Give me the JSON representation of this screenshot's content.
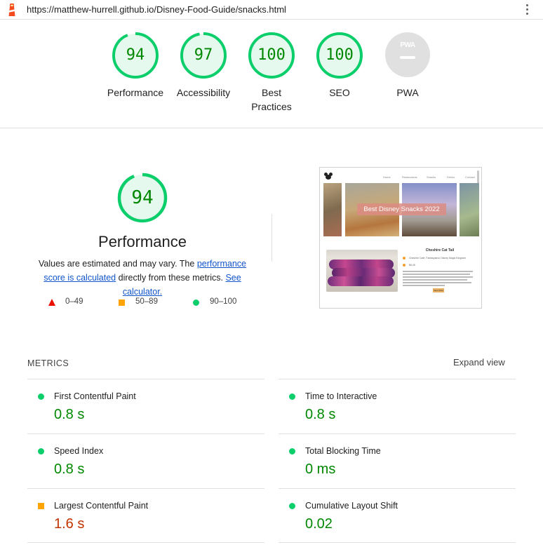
{
  "browser": {
    "url": "https://matthew-hurrell.github.io/Disney-Food-Guide/snacks.html"
  },
  "gauges": [
    {
      "label": "Performance",
      "score": "94",
      "fraction": 0.94,
      "status": "pass"
    },
    {
      "label": "Accessibility",
      "score": "97",
      "fraction": 0.97,
      "status": "pass"
    },
    {
      "label": "Best Practices",
      "score": "100",
      "fraction": 1.0,
      "status": "pass"
    },
    {
      "label": "SEO",
      "score": "100",
      "fraction": 1.0,
      "status": "pass"
    },
    {
      "label": "PWA",
      "score": "",
      "status": "na",
      "badge_text": "PWA"
    }
  ],
  "performance": {
    "score": "94",
    "fraction": 0.94,
    "title": "Performance",
    "desc_prefix": "Values are estimated and may vary. The ",
    "link_score": "performance score is calculated",
    "desc_middle": " directly from these metrics. ",
    "link_calc": "See calculator."
  },
  "legend": [
    {
      "label": "0–49",
      "shape": "triangle",
      "color": "#eb0f00"
    },
    {
      "label": "50–89",
      "shape": "square",
      "color": "#ffa400"
    },
    {
      "label": "90–100",
      "shape": "circle",
      "color": "#0cce6b"
    }
  ],
  "screenshot": {
    "nav": [
      "Home",
      "Restaurants",
      "Snacks",
      "Drinks",
      "Contact"
    ],
    "banner": "Best Disney Snacks 2022",
    "card_title": "Cheshire Cat Tail",
    "info": [
      "Cheshire Café, Fantasyland, Disney Magic Kingdom",
      "$6.49"
    ],
    "more_button": "View More"
  },
  "metrics": {
    "heading": "METRICS",
    "expand_label": "Expand view",
    "items": [
      {
        "name": "First Contentful Paint",
        "value": "0.8 s",
        "status": "pass"
      },
      {
        "name": "Time to Interactive",
        "value": "0.8 s",
        "status": "pass"
      },
      {
        "name": "Speed Index",
        "value": "0.8 s",
        "status": "pass"
      },
      {
        "name": "Total Blocking Time",
        "value": "0 ms",
        "status": "pass"
      },
      {
        "name": "Largest Contentful Paint",
        "value": "1.6 s",
        "status": "average"
      },
      {
        "name": "Cumulative Layout Shift",
        "value": "0.02",
        "status": "pass"
      }
    ]
  },
  "colors": {
    "pass": "#0cce6b",
    "pass_text": "#008800",
    "average": "#ffa400",
    "average_text": "#c33300",
    "fail": "#eb0f00",
    "logo": "#f44b21"
  }
}
